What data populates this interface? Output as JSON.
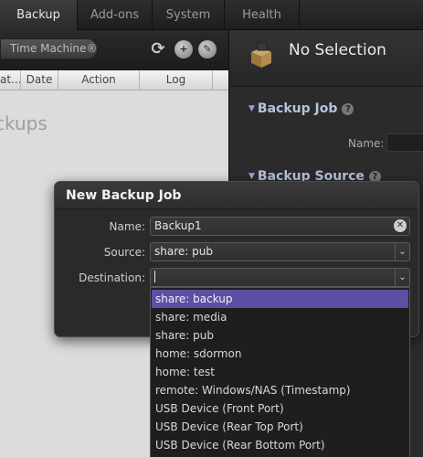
{
  "tabs": [
    {
      "label": "Backup",
      "active": true
    },
    {
      "label": "Add-ons",
      "active": false
    },
    {
      "label": "System",
      "active": false
    },
    {
      "label": "Health",
      "active": false
    }
  ],
  "toolbar": {
    "time_machine_label": "Time Machine®",
    "icons": [
      "refresh-icon",
      "add-job-icon",
      "edit-job-icon"
    ]
  },
  "table": {
    "columns": [
      "at...",
      "Date",
      "Action",
      "Log"
    ],
    "empty_text": "ckups"
  },
  "detail": {
    "title": "No Selection",
    "backup_job_section": "Backup Job",
    "backup_source_section": "Backup Source",
    "name_label": "Name:"
  },
  "dialog": {
    "title": "New Backup Job",
    "name_label": "Name:",
    "name_value": "Backup1",
    "source_label": "Source:",
    "source_value": "share: pub",
    "destination_label": "Destination:",
    "destination_value": ""
  },
  "destination_options": [
    "share: backup",
    "share: media",
    "share: pub",
    "home: sdormon",
    "home: test",
    "remote: Windows/NAS (Timestamp)",
    "USB Device (Front Port)",
    "USB Device (Rear Top Port)",
    "USB Device (Rear Bottom Port)"
  ],
  "destination_highlighted": "share: backup",
  "colors": {
    "highlight": "#5b4fa6",
    "section_title": "#b6c2dc",
    "dialog_bg": "#2a2a2a"
  }
}
